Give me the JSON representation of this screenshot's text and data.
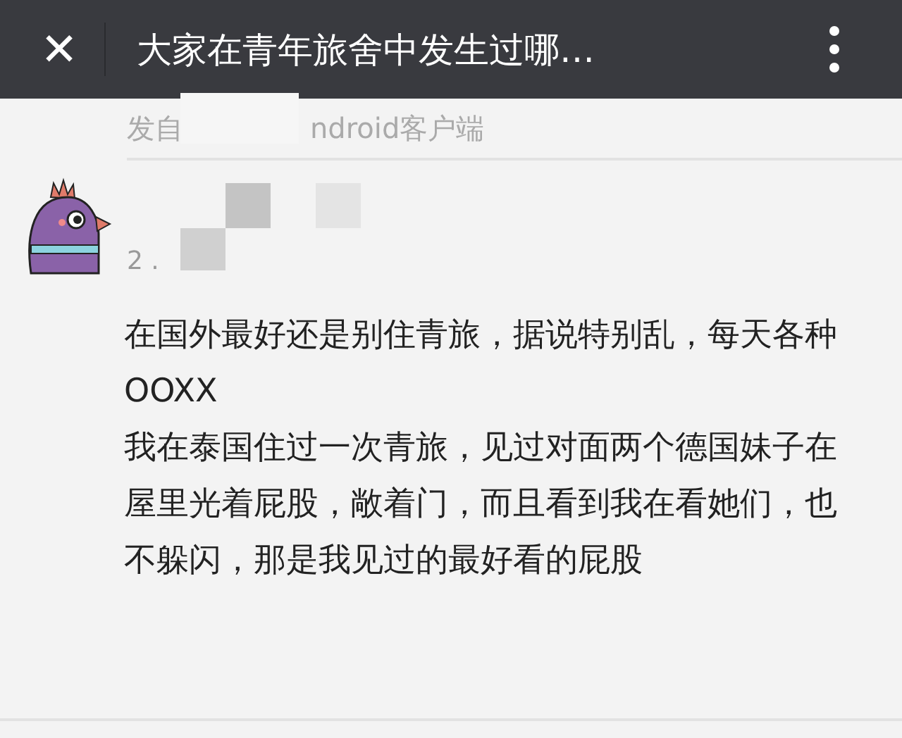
{
  "header": {
    "close": "✕",
    "title": "大家在青年旅舍中发生过哪…"
  },
  "previous_answer": {
    "source_start": "发自",
    "source_end": "ndroid客户端"
  },
  "comment": {
    "meta": "2 .",
    "paragraphs": [
      "在国外最好还是别住青旅，据说特别乱，每天各种OOXX",
      "我在泰国住过一次青旅，见过对面两个德国妹子在屋里光着屁股，敞着门，而且看到我在看她们，也不躲闪，那是我见过的最好看的屁股"
    ]
  }
}
